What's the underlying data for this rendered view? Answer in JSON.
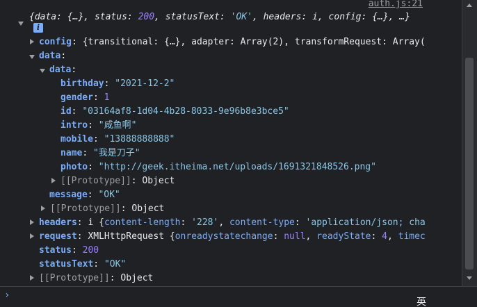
{
  "source_link": "auth.js:21",
  "info_badge": "i",
  "summary": {
    "open": "{",
    "parts": [
      {
        "k": "data",
        "v": "{…}",
        "t": "w"
      },
      {
        "k": "status",
        "v": "200",
        "t": "n"
      },
      {
        "k": "statusText",
        "v": "'OK'",
        "t": "s"
      },
      {
        "k": "headers",
        "v": "i",
        "t": "w"
      },
      {
        "k": "config",
        "v": "{…}",
        "t": "w"
      }
    ],
    "tail": ", …}"
  },
  "config_line": {
    "key": "config",
    "value": "{transitional: {…}, adapter: Array(2), transformRequest: Array("
  },
  "data_key": "data",
  "inner_data_key": "data",
  "fields": [
    {
      "key": "birthday",
      "value": "\"2021-12-2\"",
      "type": "s"
    },
    {
      "key": "gender",
      "value": "1",
      "type": "n"
    },
    {
      "key": "id",
      "value": "\"03164af8-1d04-4b28-8033-9e96b8e3bce5\"",
      "type": "s"
    },
    {
      "key": "intro",
      "value": "\"咸鱼啊\"",
      "type": "s"
    },
    {
      "key": "mobile",
      "value": "\"13888888888\"",
      "type": "s"
    },
    {
      "key": "name",
      "value": "\"我是刀子\"",
      "type": "s"
    },
    {
      "key": "photo",
      "value": "\"http://geek.itheima.net/uploads/1691321848526.png\"",
      "type": "s"
    }
  ],
  "prototype_key": "[[Prototype]]",
  "prototype_value": "Object",
  "message": {
    "key": "message",
    "value": "\"OK\""
  },
  "headers_line": {
    "key": "headers",
    "prefix": "i {",
    "k1": "content-length",
    "v1": "'228'",
    "k2": "content-type",
    "v2": "'application/json; cha"
  },
  "request_line": {
    "key": "request",
    "prefix": "XMLHttpRequest {",
    "k1": "onreadystatechange",
    "v1": "null",
    "k2": "readyState",
    "v2": "4",
    "k3": "timec"
  },
  "status": {
    "key": "status",
    "value": "200"
  },
  "statusText": {
    "key": "statusText",
    "value": "\"OK\""
  },
  "prompt_symbol": "›",
  "ime_char": "英"
}
